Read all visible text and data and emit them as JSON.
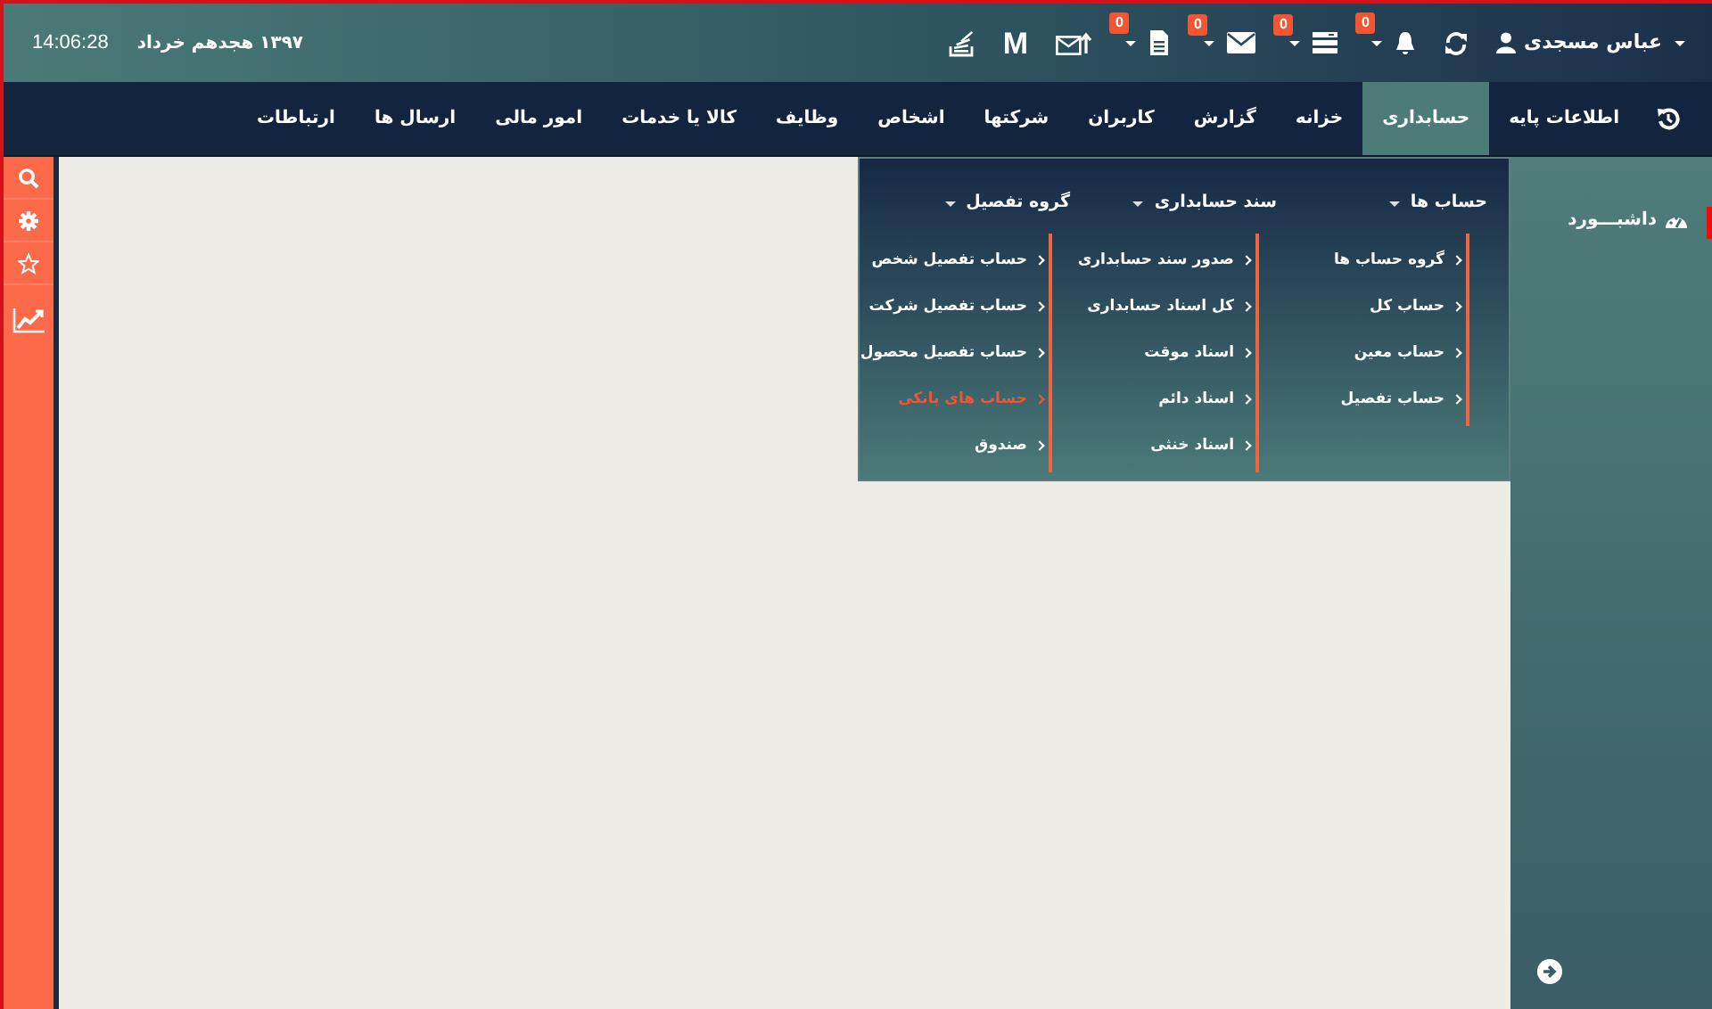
{
  "header": {
    "clock": "14:06:28",
    "date": "۱۳۹۷ هجدهم خرداد",
    "user": "عباس مسجدی",
    "tools": [
      {
        "kind": "bell",
        "badge": "0",
        "dropdown": true
      },
      {
        "kind": "list",
        "badge": "0",
        "dropdown": true
      },
      {
        "kind": "mail",
        "badge": "0",
        "dropdown": true
      },
      {
        "kind": "doc",
        "badge": "0",
        "dropdown": true
      },
      {
        "kind": "mail-up"
      },
      {
        "kind": "logo",
        "text": "M"
      },
      {
        "kind": "stack"
      }
    ]
  },
  "nav": {
    "items": [
      {
        "label": "اطلاعات پایه",
        "selected": false
      },
      {
        "label": "حسابداری",
        "selected": true
      },
      {
        "label": "خزانه",
        "selected": false
      },
      {
        "label": "گزارش",
        "selected": false
      },
      {
        "label": "کاربران",
        "selected": false
      },
      {
        "label": "شرکتها",
        "selected": false
      },
      {
        "label": "اشخاص",
        "selected": false
      },
      {
        "label": "وظایف",
        "selected": false
      },
      {
        "label": "کالا یا خدمات",
        "selected": false
      },
      {
        "label": "امور مالی",
        "selected": false
      },
      {
        "label": "ارسال ها",
        "selected": false
      },
      {
        "label": "ارتباطات",
        "selected": false
      }
    ]
  },
  "menu": {
    "columns": [
      {
        "title": "حساب ها",
        "items": [
          {
            "label": "گروه حساب ها",
            "selected": false
          },
          {
            "label": "حساب کل",
            "selected": false
          },
          {
            "label": "حساب معین",
            "selected": false
          },
          {
            "label": "حساب تفصیل",
            "selected": false
          }
        ]
      },
      {
        "title": "سند حسابداری",
        "items": [
          {
            "label": "صدور سند حسابداری",
            "selected": false
          },
          {
            "label": "کل اسناد حسابداری",
            "selected": false
          },
          {
            "label": "اسناد موقت",
            "selected": false
          },
          {
            "label": "اسناد دائم",
            "selected": false
          },
          {
            "label": "اسناد خنثی",
            "selected": false
          }
        ]
      },
      {
        "title": "گروه تفصیل",
        "items": [
          {
            "label": "حساب تفصیل شخص",
            "selected": false
          },
          {
            "label": "حساب تفصیل شرکت",
            "selected": false
          },
          {
            "label": "حساب تفصیل محصول",
            "selected": false
          },
          {
            "label": "حساب های بانکی",
            "selected": true
          },
          {
            "label": "صندوق",
            "selected": false
          }
        ]
      }
    ]
  },
  "sidebar": {
    "items": [
      {
        "label": "داشبـــورد",
        "selected": true
      }
    ]
  }
}
